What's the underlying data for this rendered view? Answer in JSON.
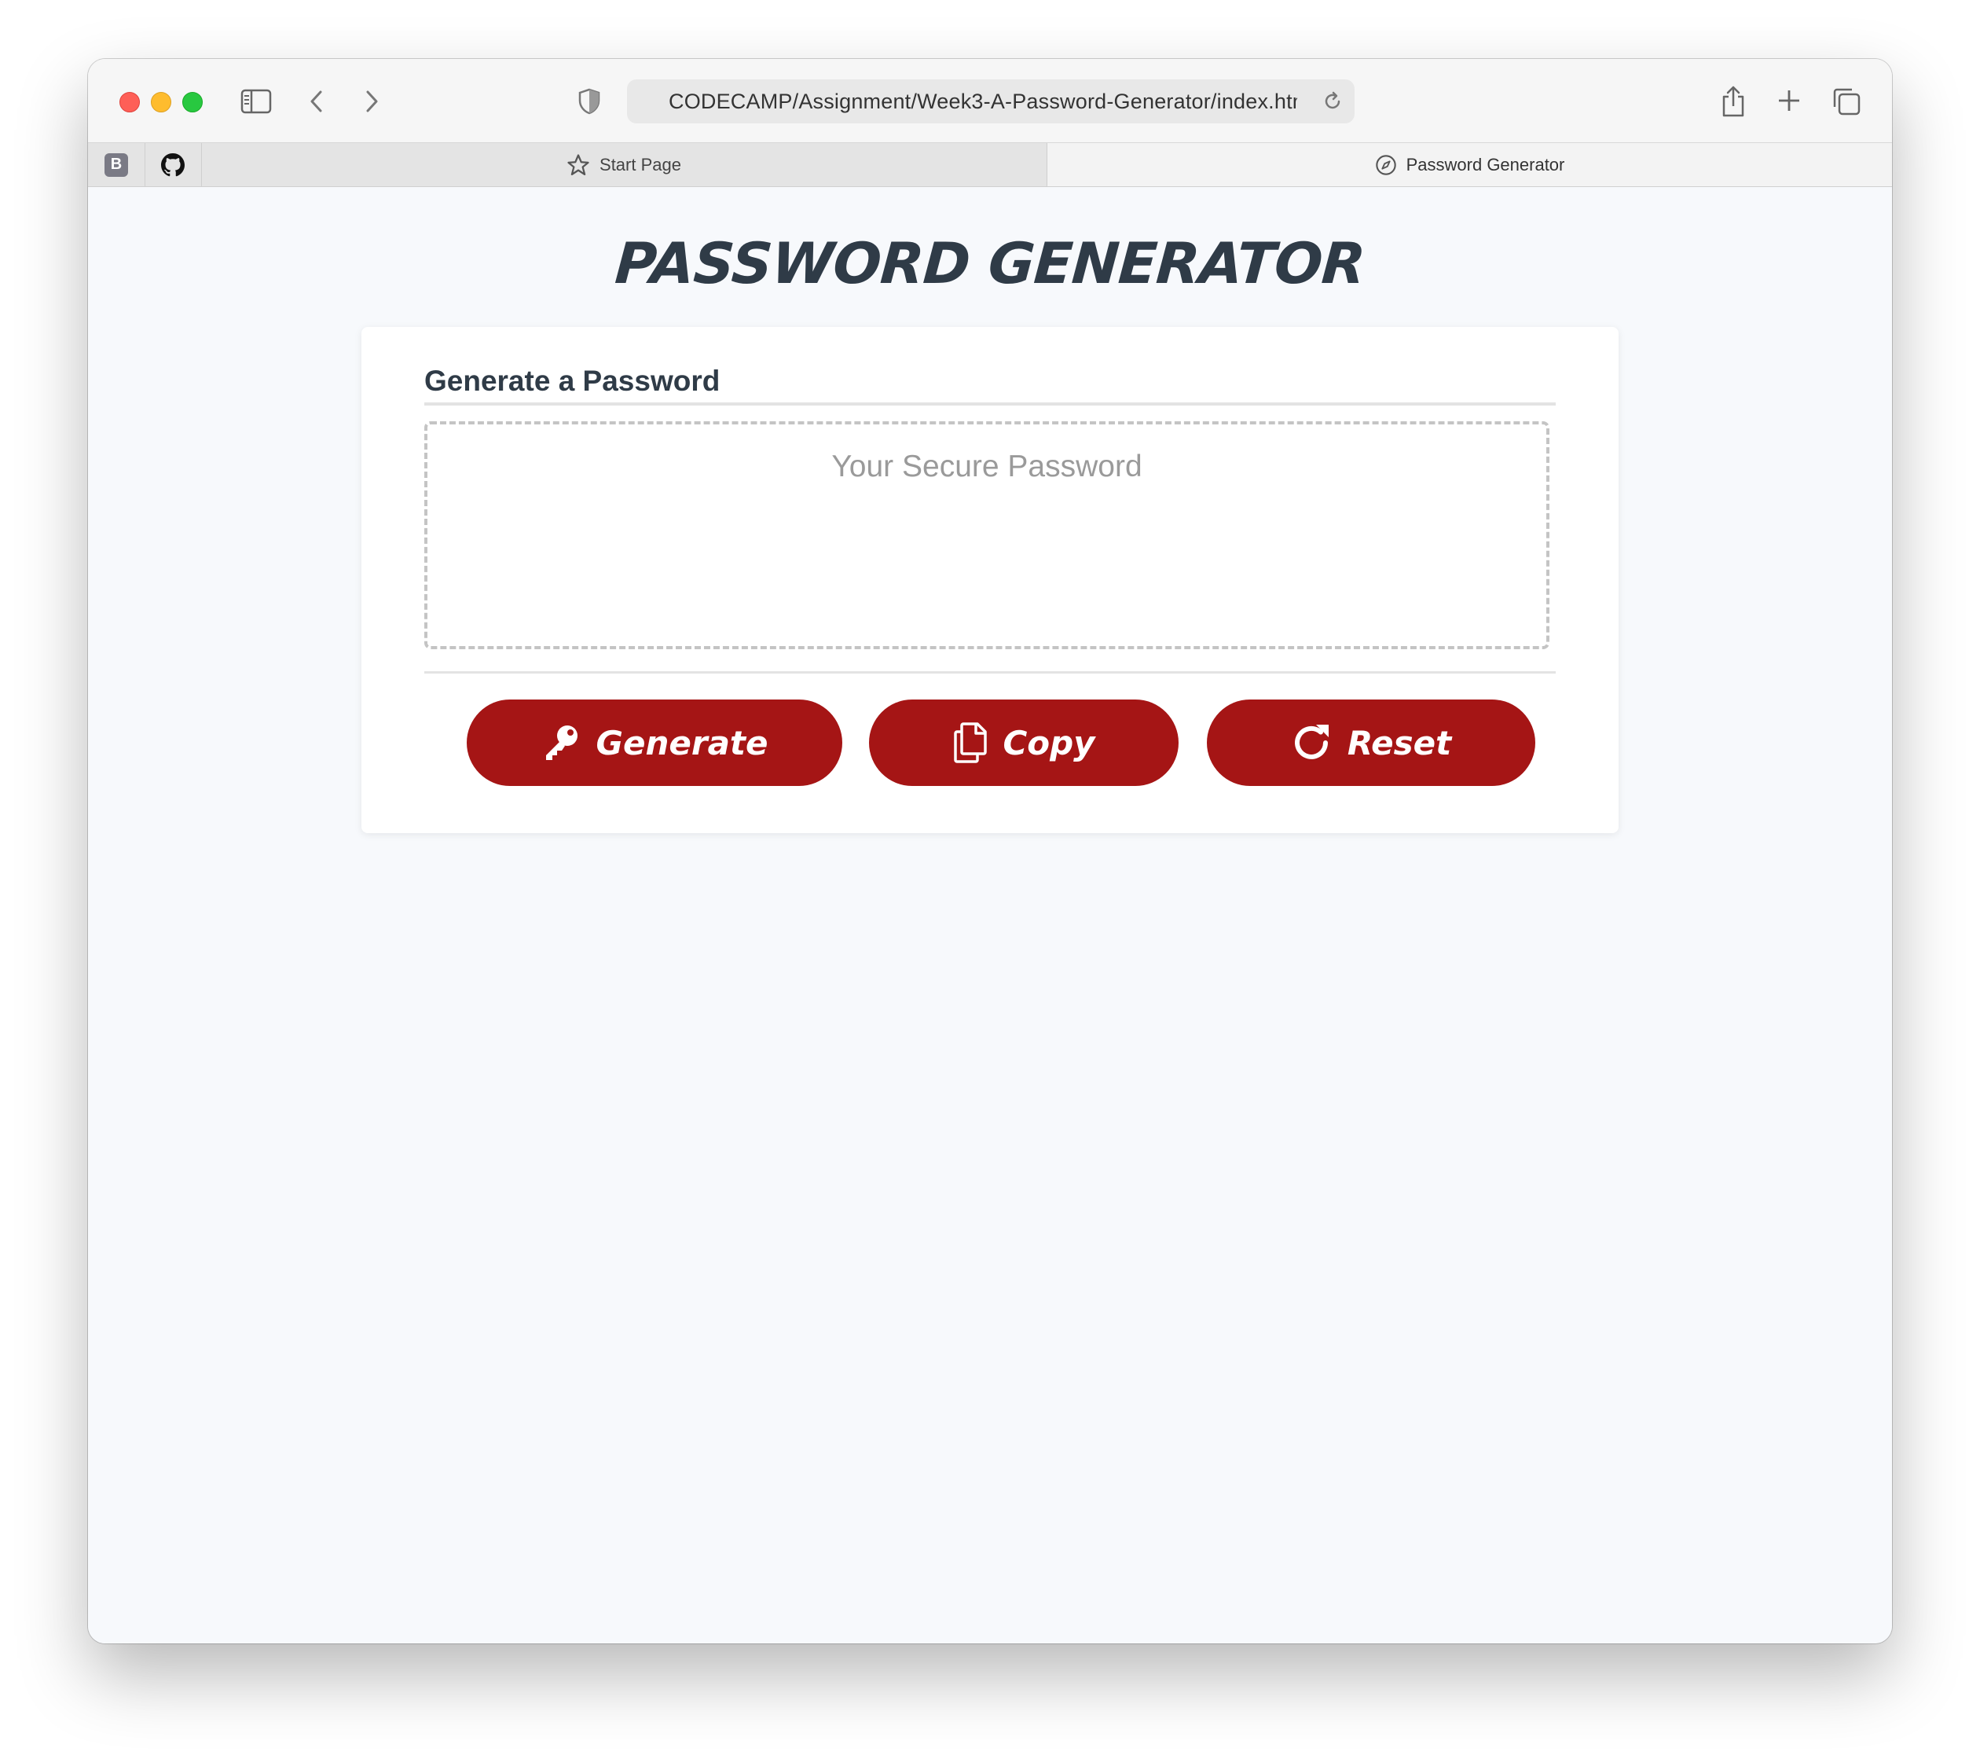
{
  "browser": {
    "url": "CODECAMP/Assignment/Week3-A-Password-Generator/index.html",
    "pinned_tabs": [
      {
        "name": "bootstrap",
        "letter": "B"
      },
      {
        "name": "github"
      }
    ],
    "tabs": [
      {
        "label": "Start Page",
        "active": false
      },
      {
        "label": "Password Generator",
        "active": true
      }
    ]
  },
  "page": {
    "title": "PASSWORD GENERATOR"
  },
  "card": {
    "header": "Generate a Password",
    "password_placeholder": "Your Secure Password"
  },
  "buttons": {
    "generate_label": "Generate",
    "copy_label": "Copy",
    "reset_label": "Reset"
  },
  "colors": {
    "accent": "#a51515",
    "heading": "#2f3b47",
    "page_background": "#f7f9fc"
  }
}
